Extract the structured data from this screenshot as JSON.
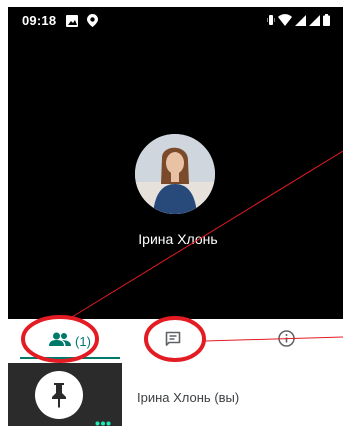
{
  "status_bar": {
    "time": "09:18",
    "left_icons": [
      "image-icon",
      "location-icon"
    ],
    "right_icons": [
      "vibrate-icon",
      "wifi-icon",
      "signal-icon",
      "signal-icon-2",
      "battery-icon"
    ]
  },
  "video": {
    "participant_name": "Ірина Хлонь"
  },
  "tabs": {
    "participants_count": "(1)",
    "items": [
      "participants-tab",
      "chat-tab",
      "info-tab"
    ],
    "accent_color": "#00796b"
  },
  "participants": [
    {
      "name": "Ірина Хлонь (вы)"
    }
  ],
  "annotation_color": "#e31b23"
}
